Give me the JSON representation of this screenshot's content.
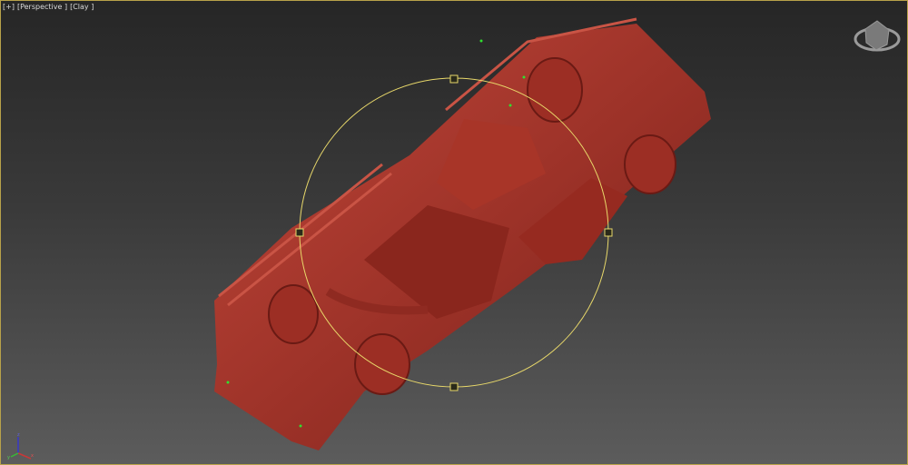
{
  "viewport": {
    "label_parts": [
      "[+]",
      "[Perspective ]",
      "[Clay ]"
    ],
    "active_border_color": "#b8a24a",
    "model_color": "#b0392d",
    "gizmo_color": "#e8d86a"
  },
  "axis_tripod": {
    "x": "x",
    "y": "y",
    "z": "z"
  },
  "icons": {
    "viewcube": "viewcube-icon",
    "axis": "axis-tripod-icon"
  }
}
